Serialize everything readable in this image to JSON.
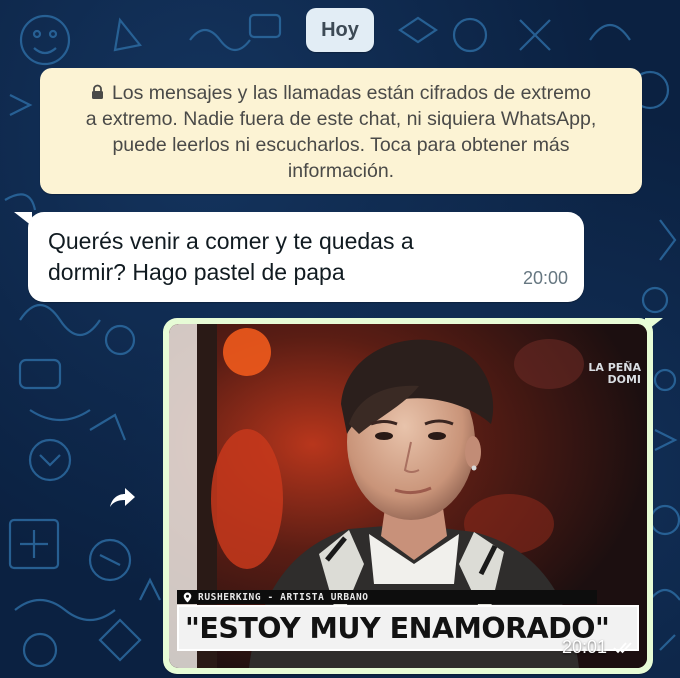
{
  "chat": {
    "date_chip": "Hoy",
    "encryption_notice": {
      "icon": "lock-icon",
      "lines": [
        "Los mensajes y las llamadas están cifrados de extremo",
        "a extremo. Nadie fuera de este chat, ni siquiera WhatsApp,",
        "puede leerlos ni escucharlos. Toca para obtener más",
        "información."
      ]
    },
    "messages": [
      {
        "direction": "incoming",
        "lines": [
          "Querés venir a comer y te quedas a",
          "dormir? Hago pastel de papa"
        ],
        "time": "20:00"
      },
      {
        "direction": "outgoing",
        "type": "image",
        "image": {
          "channel_label_1": "LA PEÑA",
          "channel_label_2": "DOMI",
          "lower_third_name": "RUSHERKING - ARTISTA URBANO",
          "lower_third_headline": "\"ESTOY MUY ENAMORADO\""
        },
        "time": "20:01",
        "status_icon": "double-check-icon"
      }
    ],
    "forward_icon": "forward-icon"
  },
  "colors": {
    "chat_background": "#0b2141",
    "doodle_stroke": "#2c6aa0",
    "incoming_bubble": "#ffffff",
    "outgoing_bubble": "#e7fcd6",
    "notice_background": "#fcf3d4",
    "date_chip_background": "#e2edf5"
  }
}
